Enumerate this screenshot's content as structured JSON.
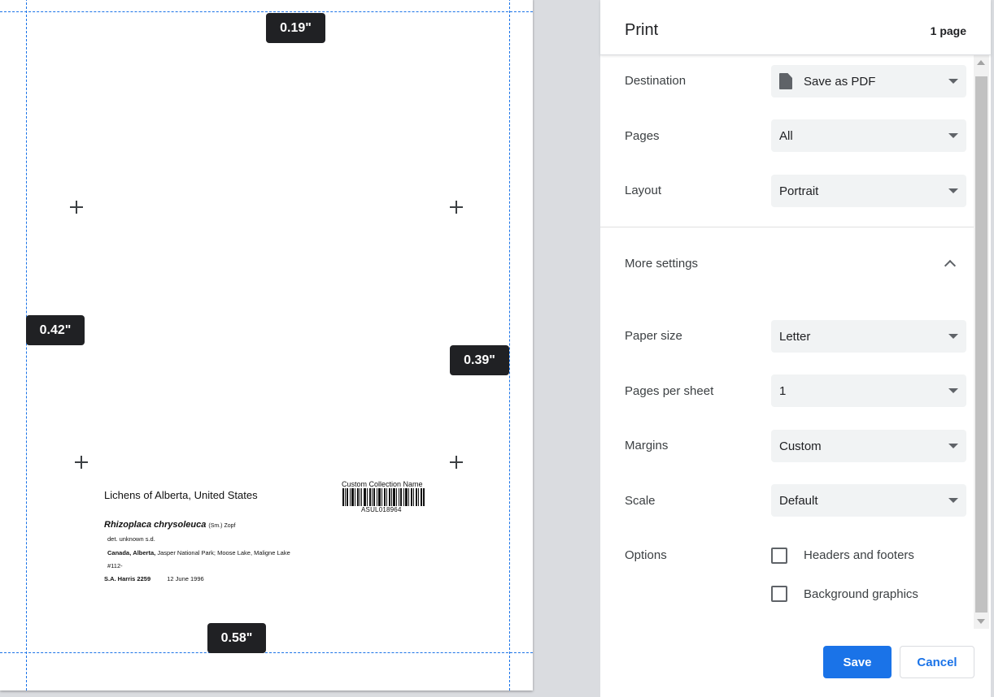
{
  "preview": {
    "margins": {
      "top": "0.19\"",
      "left": "0.42\"",
      "right": "0.39\"",
      "bottom": "0.58\""
    },
    "label": {
      "title": "Lichens of Alberta, United States",
      "collection_name": "Custom Collection Name",
      "barcode_text": "ASUL018964",
      "species_sci": "Rhizoplaca chrysoleuca",
      "species_author": "(Sm.) Zopf",
      "determination": "det. unknown   s.d.",
      "country": "Canada,",
      "province": "Alberta,",
      "locality": "Jasper National Park; Moose Lake, Maligne Lake",
      "number": "#112-",
      "collector": "S.A. Harris 2259",
      "date": "12 June 1996"
    }
  },
  "dialog": {
    "title": "Print",
    "page_count": "1 page",
    "destination": {
      "label": "Destination",
      "value": "Save as PDF",
      "icon": "file-icon"
    },
    "pages": {
      "label": "Pages",
      "value": "All"
    },
    "layout": {
      "label": "Layout",
      "value": "Portrait"
    },
    "more_settings": {
      "label": "More settings",
      "icon": "chevron-up-icon"
    },
    "paper_size": {
      "label": "Paper size",
      "value": "Letter"
    },
    "pages_per_sheet": {
      "label": "Pages per sheet",
      "value": "1"
    },
    "margins": {
      "label": "Margins",
      "value": "Custom"
    },
    "scale": {
      "label": "Scale",
      "value": "Default"
    },
    "options": {
      "label": "Options",
      "headers_footers": {
        "label": "Headers and footers",
        "checked": false
      },
      "background_graphics": {
        "label": "Background graphics",
        "checked": false
      }
    },
    "save_label": "Save",
    "cancel_label": "Cancel"
  },
  "colors": {
    "accent": "#1a73e8",
    "chip_bg": "#202124",
    "select_bg": "#f1f3f4"
  }
}
